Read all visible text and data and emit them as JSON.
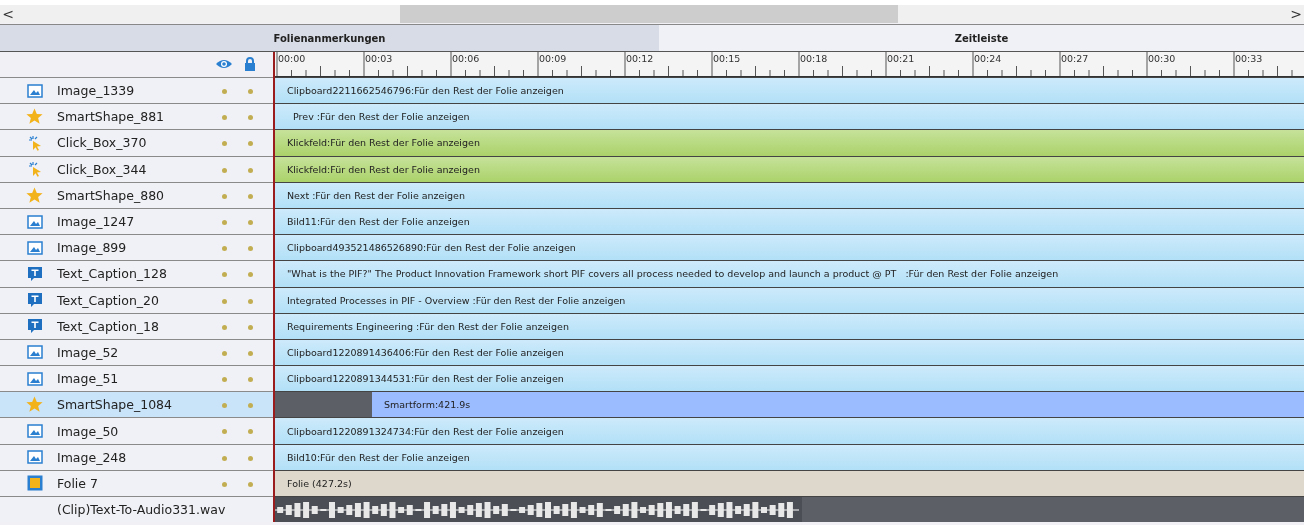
{
  "scrollbar": {
    "left": "<",
    "right": ">"
  },
  "header": {
    "notes": "Folienanmerkungen",
    "timeline": "Zeitleiste"
  },
  "ruler": [
    "00:00",
    "00:03",
    "00:06",
    "00:09",
    "00:12",
    "00:15",
    "00:18",
    "00:21",
    "00:24",
    "00:27",
    "00:30",
    "00:33"
  ],
  "rows": [
    {
      "name": "Image_1339",
      "kind": "image",
      "selected": false,
      "bar": {
        "kind": "object",
        "label": "Clipboard2211662546796:Für den Rest der Folie anzeigen"
      }
    },
    {
      "name": "SmartShape_881",
      "kind": "shape",
      "selected": false,
      "bar": {
        "kind": "object",
        "label": "  Prev :Für den Rest der Folie anzeigen"
      }
    },
    {
      "name": "Click_Box_370",
      "kind": "click",
      "selected": false,
      "bar": {
        "kind": "interactive",
        "label": "Klickfeld:Für den Rest der Folie anzeigen"
      }
    },
    {
      "name": "Click_Box_344",
      "kind": "click",
      "selected": false,
      "bar": {
        "kind": "interactive",
        "label": "Klickfeld:Für den Rest der Folie anzeigen"
      }
    },
    {
      "name": "SmartShape_880",
      "kind": "shape",
      "selected": false,
      "bar": {
        "kind": "object",
        "label": "Next :Für den Rest der Folie anzeigen"
      }
    },
    {
      "name": "Image_1247",
      "kind": "image",
      "selected": false,
      "bar": {
        "kind": "object",
        "label": "Bild11:Für den Rest der Folie anzeigen"
      }
    },
    {
      "name": "Image_899",
      "kind": "image",
      "selected": false,
      "bar": {
        "kind": "object",
        "label": "Clipboard493521486526890:Für den Rest der Folie anzeigen"
      }
    },
    {
      "name": "Text_Caption_128",
      "kind": "caption",
      "selected": false,
      "bar": {
        "kind": "object",
        "label": "\"What is the PIF?\" The Product Innovation Framework short PIF covers all process needed to develop and launch a product @ PT   :Für den Rest der Folie anzeigen"
      }
    },
    {
      "name": "Text_Caption_20",
      "kind": "caption",
      "selected": false,
      "bar": {
        "kind": "object",
        "label": "Integrated Processes in PIF - Overview :Für den Rest der Folie anzeigen"
      }
    },
    {
      "name": "Text_Caption_18",
      "kind": "caption",
      "selected": false,
      "bar": {
        "kind": "object",
        "label": "Requirements Engineering :Für den Rest der Folie anzeigen"
      }
    },
    {
      "name": "Image_52",
      "kind": "image",
      "selected": false,
      "bar": {
        "kind": "object",
        "label": "Clipboard1220891436406:Für den Rest der Folie anzeigen"
      }
    },
    {
      "name": "Image_51",
      "kind": "image",
      "selected": false,
      "bar": {
        "kind": "object",
        "label": "Clipboard1220891344531:Für den Rest der Folie anzeigen"
      }
    },
    {
      "name": "SmartShape_1084",
      "kind": "shape",
      "selected": true,
      "bar": {
        "kind": "delayed",
        "label": "Smartform:421.9s"
      }
    },
    {
      "name": "Image_50",
      "kind": "image",
      "selected": false,
      "bar": {
        "kind": "object",
        "label": "Clipboard1220891324734:Für den Rest der Folie anzeigen"
      }
    },
    {
      "name": "Image_248",
      "kind": "image",
      "selected": false,
      "bar": {
        "kind": "object",
        "label": "Bild10:Für den Rest der Folie anzeigen"
      }
    },
    {
      "name": "Folie 7",
      "kind": "slide",
      "selected": false,
      "bar": {
        "kind": "slide",
        "label": "Folie (427.2s)"
      }
    },
    {
      "name": "(Clip)Text-To-Audio331.wav",
      "kind": "audio",
      "selected": false,
      "bar": {
        "kind": "audio"
      }
    }
  ]
}
